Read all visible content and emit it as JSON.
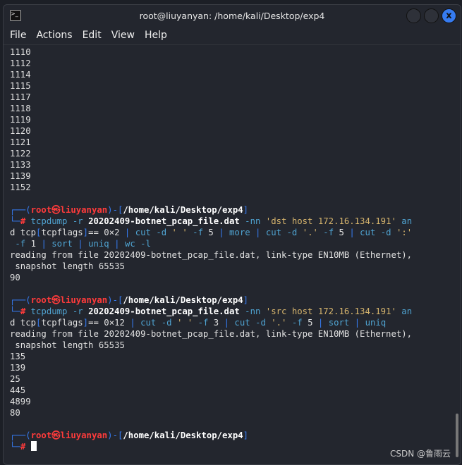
{
  "window": {
    "title": "root@liuyanyan: /home/kali/Desktop/exp4",
    "close_label": "x"
  },
  "menu": [
    "File",
    "Actions",
    "Edit",
    "View",
    "Help"
  ],
  "output_top": [
    "1110",
    "1112",
    "1114",
    "1115",
    "1117",
    "1118",
    "1119",
    "1120",
    "1121",
    "1122",
    "1133",
    "1139",
    "1152"
  ],
  "lines": [
    [
      [
        "",
        ""
      ]
    ],
    [
      [
        "b",
        "┌──("
      ],
      [
        "r",
        "root㉿liuyanyan"
      ],
      [
        "b",
        ")-["
      ],
      [
        "w",
        "/home/kali/Desktop/exp4"
      ],
      [
        "b",
        "]"
      ]
    ],
    [
      [
        "b",
        "└─"
      ],
      [
        "r",
        "# "
      ],
      [
        "cy",
        "tcpdump -r "
      ],
      [
        "w",
        "20202409-botnet_pcap_file.dat"
      ],
      [
        "cy",
        " -nn "
      ],
      [
        "y",
        "'dst host 172.16.134.191'"
      ],
      [
        "cy",
        " an"
      ]
    ],
    [
      [
        "",
        "d tcp"
      ],
      [
        "b",
        "["
      ],
      [
        "",
        "tcpflags"
      ],
      [
        "b",
        "]"
      ],
      [
        "",
        "== 0×2 "
      ],
      [
        "b",
        "| "
      ],
      [
        "cy",
        "cut -d "
      ],
      [
        "y",
        "' '"
      ],
      [
        "cy",
        " -f "
      ],
      [
        "",
        "5 "
      ],
      [
        "b",
        "| "
      ],
      [
        "cy",
        "more "
      ],
      [
        "b",
        "| "
      ],
      [
        "cy",
        "cut -d "
      ],
      [
        "y",
        "'.'"
      ],
      [
        "cy",
        " -f "
      ],
      [
        "",
        "5 "
      ],
      [
        "b",
        "| "
      ],
      [
        "cy",
        "cut -d "
      ],
      [
        "y",
        "':'"
      ]
    ],
    [
      [
        "",
        " "
      ],
      [
        "cy",
        "-f "
      ],
      [
        "",
        "1 "
      ],
      [
        "b",
        "| "
      ],
      [
        "cy",
        "sort "
      ],
      [
        "b",
        "| "
      ],
      [
        "cy",
        "uniq "
      ],
      [
        "b",
        "| "
      ],
      [
        "cy",
        "wc -l"
      ]
    ],
    [
      [
        "",
        "reading from file 20202409-botnet_pcap_file.dat, link-type EN10MB (Ethernet),"
      ]
    ],
    [
      [
        "",
        " snapshot length 65535"
      ]
    ],
    [
      [
        "",
        "90"
      ]
    ],
    [
      [
        "",
        ""
      ]
    ],
    [
      [
        "b",
        "┌──("
      ],
      [
        "r",
        "root㉿liuyanyan"
      ],
      [
        "b",
        ")-["
      ],
      [
        "w",
        "/home/kali/Desktop/exp4"
      ],
      [
        "b",
        "]"
      ]
    ],
    [
      [
        "b",
        "└─"
      ],
      [
        "r",
        "# "
      ],
      [
        "cy",
        "tcpdump -r "
      ],
      [
        "w",
        "20202409-botnet_pcap_file.dat"
      ],
      [
        "cy",
        " -nn "
      ],
      [
        "y",
        "'src host 172.16.134.191'"
      ],
      [
        "cy",
        " an"
      ]
    ],
    [
      [
        "",
        "d tcp"
      ],
      [
        "b",
        "["
      ],
      [
        "",
        "tcpflags"
      ],
      [
        "b",
        "]"
      ],
      [
        "",
        "== 0×12 "
      ],
      [
        "b",
        "| "
      ],
      [
        "cy",
        "cut -d "
      ],
      [
        "y",
        "' '"
      ],
      [
        "cy",
        " -f "
      ],
      [
        "",
        "3 "
      ],
      [
        "b",
        "| "
      ],
      [
        "cy",
        "cut -d "
      ],
      [
        "y",
        "'.'"
      ],
      [
        "cy",
        " -f "
      ],
      [
        "",
        "5 "
      ],
      [
        "b",
        "| "
      ],
      [
        "cy",
        "sort "
      ],
      [
        "b",
        "| "
      ],
      [
        "cy",
        "uniq"
      ]
    ],
    [
      [
        "",
        "reading from file 20202409-botnet_pcap_file.dat, link-type EN10MB (Ethernet),"
      ]
    ],
    [
      [
        "",
        " snapshot length 65535"
      ]
    ],
    [
      [
        "",
        "135"
      ]
    ],
    [
      [
        "",
        "139"
      ]
    ],
    [
      [
        "",
        "25"
      ]
    ],
    [
      [
        "",
        "445"
      ]
    ],
    [
      [
        "",
        "4899"
      ]
    ],
    [
      [
        "",
        "80"
      ]
    ],
    [
      [
        "",
        ""
      ]
    ],
    [
      [
        "b",
        "┌──("
      ],
      [
        "r",
        "root㉿liuyanyan"
      ],
      [
        "b",
        ")-["
      ],
      [
        "w",
        "/home/kali/Desktop/exp4"
      ],
      [
        "b",
        "]"
      ]
    ],
    [
      [
        "b",
        "└─"
      ],
      [
        "r",
        "# "
      ]
    ]
  ],
  "watermark": "CSDN @鲁雨云"
}
